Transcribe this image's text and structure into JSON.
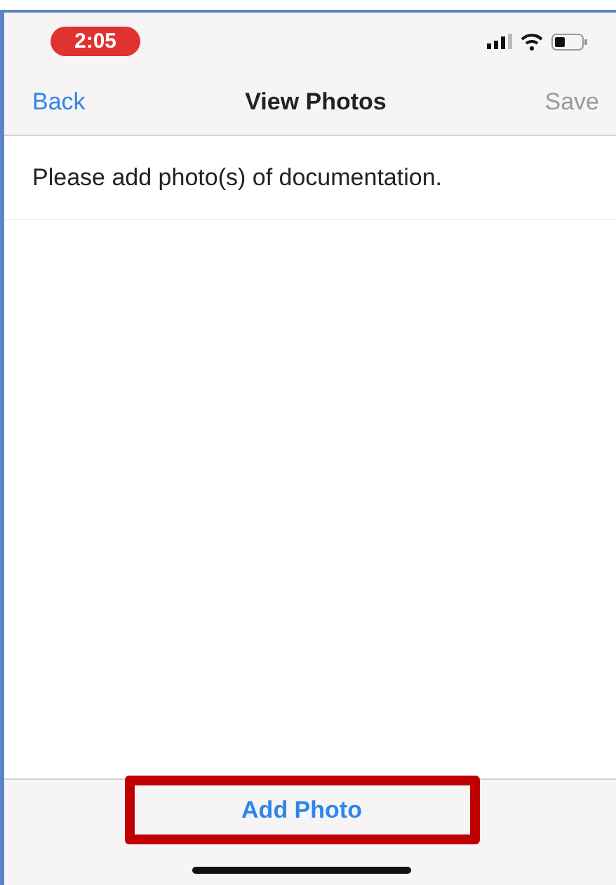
{
  "status_bar": {
    "time": "2:05"
  },
  "nav_bar": {
    "back": "Back",
    "title": "View Photos",
    "save": {
      "label": "Save",
      "disabled": true
    }
  },
  "message": "Please add photo(s) of documentation.",
  "bottom_bar": {
    "button": {
      "label": "Add Photo",
      "highlighted": true
    }
  }
}
